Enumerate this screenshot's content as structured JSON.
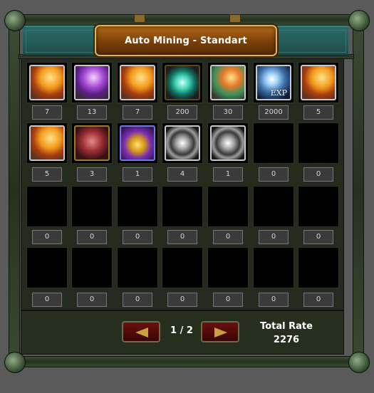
{
  "window": {
    "title": "Auto Mining - Standart"
  },
  "grid": {
    "rows": [
      [
        {
          "icon": "scroll-orange",
          "count": "7"
        },
        {
          "icon": "scroll-purple",
          "count": "13"
        },
        {
          "icon": "scroll-orange",
          "count": "7"
        },
        {
          "icon": "gem",
          "count": "200"
        },
        {
          "icon": "scroll-green",
          "count": "30"
        },
        {
          "icon": "exp",
          "count": "2000",
          "tag": "EXP"
        },
        {
          "icon": "scroll-orange",
          "count": "5"
        }
      ],
      [
        {
          "icon": "scroll-orange",
          "count": "5"
        },
        {
          "icon": "helm",
          "count": "3"
        },
        {
          "icon": "chest",
          "count": "1"
        },
        {
          "icon": "wheel",
          "count": "4"
        },
        {
          "icon": "wheel",
          "count": "1"
        },
        {
          "icon": null,
          "count": "0"
        },
        {
          "icon": null,
          "count": "0"
        }
      ],
      [
        {
          "icon": null,
          "count": "0"
        },
        {
          "icon": null,
          "count": "0"
        },
        {
          "icon": null,
          "count": "0"
        },
        {
          "icon": null,
          "count": "0"
        },
        {
          "icon": null,
          "count": "0"
        },
        {
          "icon": null,
          "count": "0"
        },
        {
          "icon": null,
          "count": "0"
        }
      ],
      [
        {
          "icon": null,
          "count": "0"
        },
        {
          "icon": null,
          "count": "0"
        },
        {
          "icon": null,
          "count": "0"
        },
        {
          "icon": null,
          "count": "0"
        },
        {
          "icon": null,
          "count": "0"
        },
        {
          "icon": null,
          "count": "0"
        },
        {
          "icon": null,
          "count": "0"
        }
      ]
    ]
  },
  "pagination": {
    "label": "1 / 2",
    "prev_icon": "arrow-left-icon",
    "next_icon": "arrow-right-icon"
  },
  "total_rate": {
    "label": "Total Rate",
    "value": "2276"
  },
  "colors": {
    "title_plate": "#9a5410",
    "title_border": "#e0b356",
    "panel": "#242b1e",
    "teal": "#2c6c68"
  }
}
